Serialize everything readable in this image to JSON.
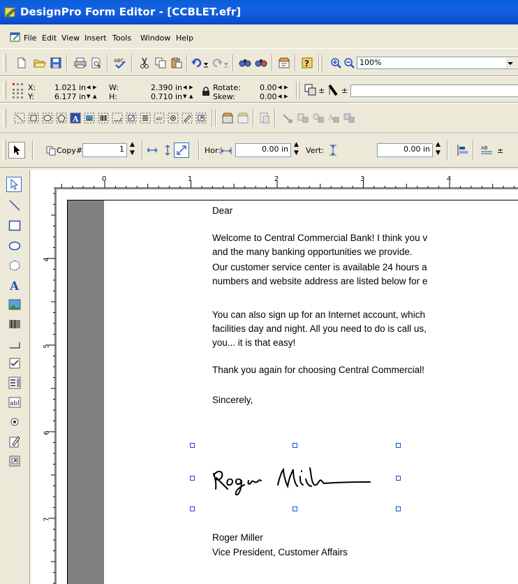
{
  "window": {
    "title": "DesignPro Form Editor - [CCBLET.efr]"
  },
  "menu": {
    "items": [
      "File",
      "Edit",
      "View",
      "Insert",
      "Tools",
      "Window",
      "Help"
    ]
  },
  "standard_toolbar": {
    "zoom_value": "100%"
  },
  "position_toolbar": {
    "x_label": "X:",
    "x_value": "1.021 in",
    "y_label": "Y:",
    "y_value": "6.177 in",
    "w_label": "W:",
    "w_value": "2.390 in",
    "h_label": "H:",
    "h_value": "0.710 in",
    "rotate_label": "Rotate:",
    "rotate_value": "0.00",
    "skew_label": "Skew:",
    "skew_value": "0.00"
  },
  "copy_toolbar": {
    "copy_label": "Copy#",
    "copy_value": "1",
    "hor_label": "Hor:",
    "hor_value": "0.00 in",
    "vert_label": "Vert:",
    "vert_value": "0.00 in"
  },
  "rulers": {
    "horizontal_labels": [
      "0",
      "1",
      "2",
      "3",
      "4"
    ],
    "vertical_labels": [
      "4",
      "5",
      "6",
      "7"
    ]
  },
  "letter": {
    "salutation": "Dear",
    "p1_line1": "Welcome to Central Commercial Bank!  I think you v",
    "p1_line2": "and the many banking opportunities we provide.",
    "p2_line1": "Our customer service center is available 24 hours a",
    "p2_line2": "numbers and website address are listed below for e",
    "p3_line1": "You can also sign up for an Internet account, which",
    "p3_line2": "facilities day and night.  All you need to do is call us,",
    "p3_line3": "you... it is that easy!",
    "p4_line1": "Thank you again for choosing Central Commercial!",
    "closing": "Sincerely,",
    "signer_name": "Roger Miller",
    "signer_title": "Vice President, Customer Affairs"
  }
}
